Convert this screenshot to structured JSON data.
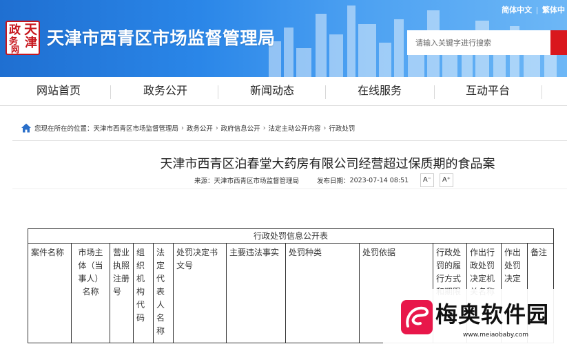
{
  "header": {
    "site_title": "天津市西青区市场监督管理局",
    "logo_glyphs": [
      "政",
      "天",
      "务",
      "津",
      "网",
      ""
    ],
    "lang_simplified": "简体中文",
    "lang_separator": "|",
    "lang_traditional": "繁体中",
    "search_placeholder": "请输入关键字进行搜索",
    "accent_color": "#d9171d",
    "banner_color": "#2a86e8"
  },
  "nav": {
    "items": [
      {
        "label": "网站首页"
      },
      {
        "label": "政务公开"
      },
      {
        "label": "新闻动态"
      },
      {
        "label": "在线服务"
      },
      {
        "label": "互动平台"
      }
    ]
  },
  "breadcrumb": {
    "prefix": "您现在所在的位置：",
    "items": [
      "天津市西青区市场监督管理局",
      "政务公开",
      "政府信息公开",
      "法定主动公开内容",
      "行政处罚"
    ],
    "separator": "›"
  },
  "article": {
    "title": "天津市西青区泊春堂大药房有限公司经营超过保质期的食品案",
    "source_label": "来源：",
    "source_value": "天津市西青区市场监督管理局",
    "date_label": "发布日期：",
    "date_value": "2023-07-14 08:51",
    "font_smaller": "A⁻",
    "font_larger": "A⁺"
  },
  "table": {
    "caption": "行政处罚信息公开表",
    "headers": [
      "案件名称",
      "市场主体（当事人）名称",
      "营业执照注册号",
      "组织机构代码",
      "法定代表人名称",
      "处罚决定书文号",
      "主要违法事实",
      "处罚种类",
      "处罚依据",
      "行政处罚的履行方式和期限",
      "作出行政处罚决定机关名称",
      "作出处罚决定",
      "备注"
    ]
  },
  "watermark": {
    "title": "梅奥软件园",
    "url": "www.meiaobaby.com"
  }
}
